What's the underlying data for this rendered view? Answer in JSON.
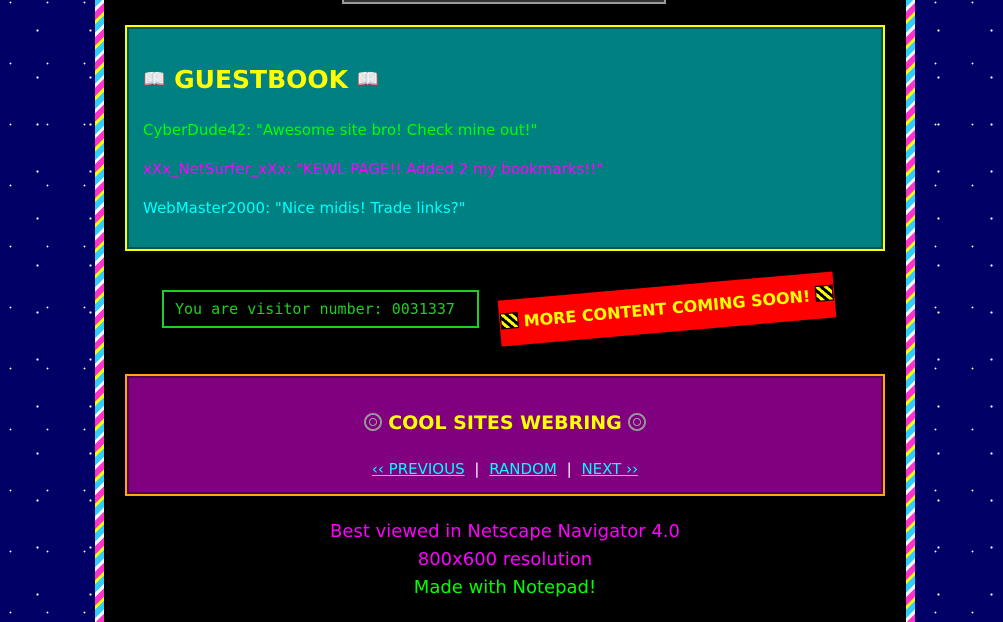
{
  "guestbook": {
    "title": "GUESTBOOK",
    "title_icon": "open-book-icon",
    "entries": [
      {
        "text": "CyberDude42: \"Awesome site bro! Check mine out!\"",
        "color": "#00ff00"
      },
      {
        "text": "xXx_NetSurfer_xXx: \"KEWL PAGE!! Added 2 my bookmarks!!\"",
        "color": "#ff00ff"
      },
      {
        "text": "WebMaster2000: \"Nice midis! Trade links?\"",
        "color": "#00ffff"
      }
    ]
  },
  "visitor_counter": {
    "text": "You are visitor number: 0031337"
  },
  "banner": {
    "text": "MORE CONTENT COMING SOON!",
    "icon": "checkered-flag-icon"
  },
  "webring": {
    "title": "COOL SITES WEBRING",
    "title_icon": "spiderweb-icon",
    "prev_label": "‹‹ PREVIOUS",
    "random_label": "RANDOM",
    "next_label": "NEXT ››",
    "separator": "|"
  },
  "footer": {
    "line1": "Best viewed in Netscape Navigator 4.0",
    "line2": "800x600 resolution",
    "line3": "Made with Notepad!"
  },
  "colors": {
    "page_background": "#000066",
    "content_background": "#000000",
    "guestbook_background": "#008080",
    "webring_background": "#800080",
    "title_yellow": "#ffff00",
    "link_cyan": "#00ffff",
    "banner_red": "#ff0000",
    "counter_green": "#22cc22"
  }
}
